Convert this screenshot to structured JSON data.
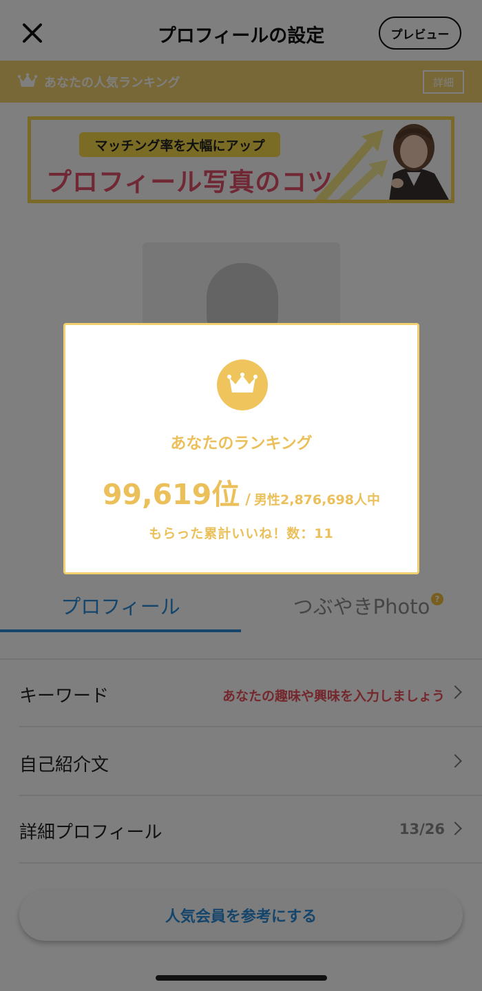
{
  "header": {
    "title": "プロフィールの設定",
    "preview_label": "プレビュー"
  },
  "ranking_bar": {
    "label": "あなたの人気ランキング",
    "detail_label": "詳細"
  },
  "banner": {
    "pill_text": "マッチング率を大幅にアップ",
    "title": "プロフィール写真のコツ"
  },
  "tabs": [
    {
      "label": "プロフィール",
      "active": true
    },
    {
      "label": "つぶやきPhoto",
      "active": false
    }
  ],
  "help_icon_glyph": "?",
  "rows": [
    {
      "label": "キーワード",
      "value": "あなたの趣味や興味を入力しましょう"
    },
    {
      "label": "自己紹介文",
      "value": ""
    },
    {
      "label": "詳細プロフィール",
      "value": "13/26"
    }
  ],
  "reference_button": "人気会員を参考にする",
  "modal": {
    "heading": "あなたのランキング",
    "rank": "99,619位",
    "separator": "/",
    "total": "男性2,876,698人中",
    "likes": "もらった累計いいね！数：11"
  },
  "colors": {
    "gold": "#f3d06e",
    "modal_gold": "#ebc05a",
    "accent_blue": "#2a8ad6",
    "accent_red": "#e8505b",
    "banner_pink": "#e0506a"
  }
}
